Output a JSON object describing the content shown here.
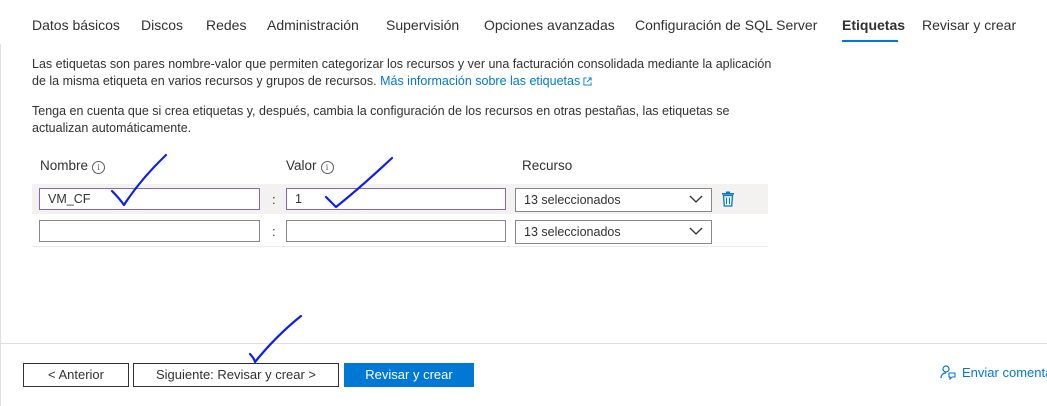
{
  "tabs": [
    {
      "label": "Datos básicos"
    },
    {
      "label": "Discos"
    },
    {
      "label": "Redes"
    },
    {
      "label": "Administración"
    },
    {
      "label": "Supervisión"
    },
    {
      "label": "Opciones avanzadas"
    },
    {
      "label": "Configuración de SQL Server"
    },
    {
      "label": "Etiquetas"
    },
    {
      "label": "Revisar y crear"
    }
  ],
  "active_tab": "Etiquetas",
  "intro": {
    "text": "Las etiquetas son pares nombre-valor que permiten categorizar los recursos y ver una facturación consolidada mediante la aplicación de la misma etiqueta en varios recursos y grupos de recursos.",
    "link": "Más información sobre las etiquetas"
  },
  "note": "Tenga en cuenta que si crea etiquetas y, después, cambia la configuración de los recursos en otras pestañas, las etiquetas se actualizan automáticamente.",
  "columns": {
    "name": "Nombre",
    "value": "Valor",
    "resource": "Recurso"
  },
  "rows": [
    {
      "name": "VM_CF",
      "separator": ":",
      "value": "1",
      "resource": "13 seleccionados"
    },
    {
      "name": "",
      "separator": ":",
      "value": "",
      "resource": "13 seleccionados"
    }
  ],
  "footer": {
    "prev": "< Anterior",
    "next": "Siguiente: Revisar y crear >",
    "create": "Revisar y crear",
    "feedback": "Enviar comenta"
  },
  "colors": {
    "accent": "#0078d4",
    "focus_border": "#8764b8",
    "annotation": "#0a1ef0"
  },
  "icons": [
    "info-icon",
    "external-link-icon",
    "chevron-down-icon",
    "trash-icon",
    "feedback-icon"
  ]
}
